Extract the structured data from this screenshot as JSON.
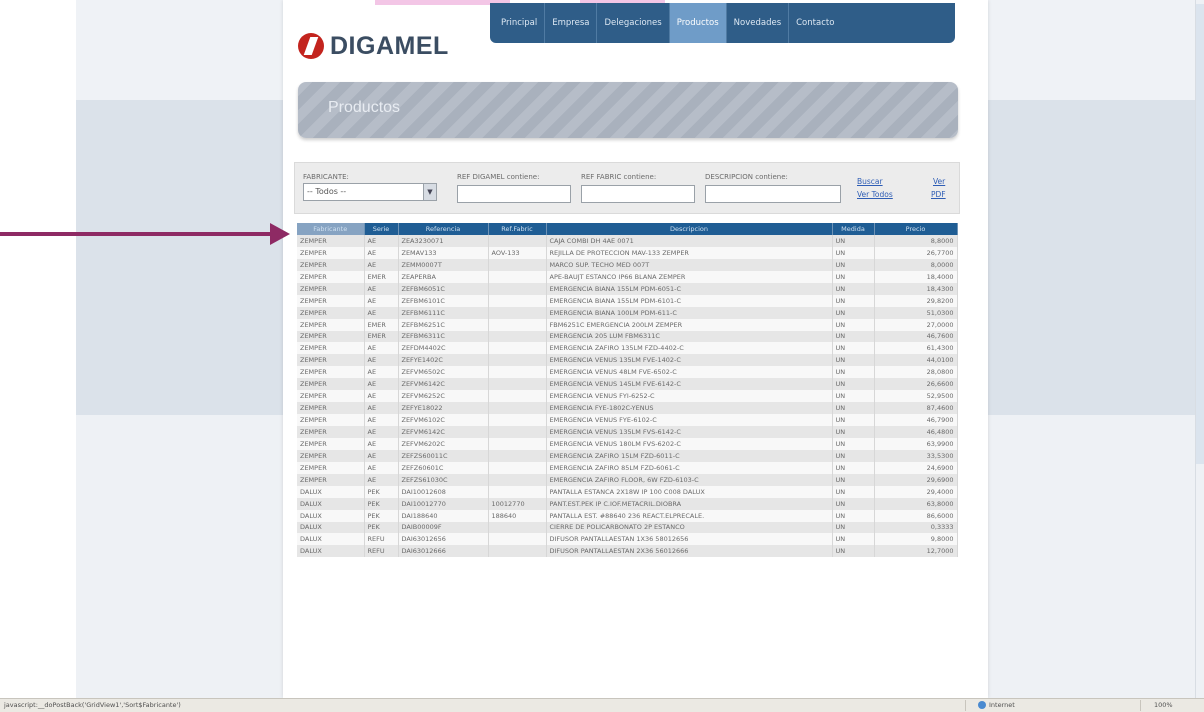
{
  "site": {
    "logo_text": "DIGAMEL",
    "colors": {
      "nav_bg": "#2f5d88",
      "nav_active": "#6f9cc8",
      "logo_red": "#c3241e",
      "table_header": "#1f5d94",
      "arrow": "#8e2a64"
    }
  },
  "nav": {
    "items": [
      "Principal",
      "Empresa",
      "Delegaciones",
      "Productos",
      "Novedades",
      "Contacto"
    ],
    "active": "Productos"
  },
  "banner": {
    "title": "Productos"
  },
  "filters": {
    "fabricante_label": "FABRICANTE:",
    "fabricante_value": "-- Todos --",
    "ref_digamel_label": "REF DIGAMEL contiene:",
    "ref_fabric_label": "REF FABRIC contiene:",
    "descripcion_label": "DESCRIPCION contiene:",
    "buscar_label": "Buscar",
    "ver_todos_label": "Ver Todos",
    "ver_label": "Ver",
    "pdf_label": "PDF"
  },
  "table": {
    "columns": [
      "Fabricante",
      "Serie",
      "Referencia",
      "Ref.Fabric",
      "Descripcion",
      "Medida",
      "Precio"
    ],
    "rows": [
      [
        "ZEMPER",
        "AE",
        "ZEA3230071",
        "",
        "CAJA COMBI DH 4AE 0071",
        "UN",
        "8,8000"
      ],
      [
        "ZEMPER",
        "AE",
        "ZEMAV133",
        "AOV-133",
        "REJILLA DE PROTECCION MAV-133 ZEMPER",
        "UN",
        "26,7700"
      ],
      [
        "ZEMPER",
        "AE",
        "ZEMM0007T",
        "",
        "MARCO SUP. TECHO MED 007T",
        "UN",
        "8,0000"
      ],
      [
        "ZEMPER",
        "EMER",
        "ZEAPERBA",
        "",
        "APE-BAUJT ESTANCO IP66 BLANA ZEMPER",
        "UN",
        "18,4000"
      ],
      [
        "ZEMPER",
        "AE",
        "ZEFBM6051C",
        "",
        "EMERGENCIA BIANA 155LM PDM-6051-C",
        "UN",
        "18,4300"
      ],
      [
        "ZEMPER",
        "AE",
        "ZEFBM6101C",
        "",
        "EMERGENCIA BIANA 155LM PDM-6101-C",
        "UN",
        "29,8200"
      ],
      [
        "ZEMPER",
        "AE",
        "ZEFBM6111C",
        "",
        "EMERGENCIA BIANA 100LM PDM-611-C",
        "UN",
        "51,0300"
      ],
      [
        "ZEMPER",
        "EMER",
        "ZEFBM6251C",
        "",
        "FBM6251C EMERGENCIA 200LM ZEMPER",
        "UN",
        "27,0000"
      ],
      [
        "ZEMPER",
        "EMER",
        "ZEFBM6311C",
        "",
        "EMERGENCIA 205 LUM FBM6311C",
        "UN",
        "46,7600"
      ],
      [
        "ZEMPER",
        "AE",
        "ZEFDM4402C",
        "",
        "EMERGENCIA ZAFIRO 135LM FZD-4402-C",
        "UN",
        "61,4300"
      ],
      [
        "ZEMPER",
        "AE",
        "ZEFYE1402C",
        "",
        "EMERGENCIA VENUS 135LM FVE-1402-C",
        "UN",
        "44,0100"
      ],
      [
        "ZEMPER",
        "AE",
        "ZEFVM6502C",
        "",
        "EMERGENCIA VENUS 48LM FVE-6502-C",
        "UN",
        "28,0800"
      ],
      [
        "ZEMPER",
        "AE",
        "ZEFVM6142C",
        "",
        "EMERGENCIA VENUS 145LM FVE-6142-C",
        "UN",
        "26,6600"
      ],
      [
        "ZEMPER",
        "AE",
        "ZEFVM6252C",
        "",
        "EMERGENCIA VENUS FYI-6252-C",
        "UN",
        "52,9500"
      ],
      [
        "ZEMPER",
        "AE",
        "ZEFYE18022",
        "",
        "EMERGENCIA FYE-1802C-YENUS",
        "UN",
        "87,4600"
      ],
      [
        "ZEMPER",
        "AE",
        "ZEFVM6102C",
        "",
        "EMERGENCIA VENUS FYE-6102-C",
        "UN",
        "46,7900"
      ],
      [
        "ZEMPER",
        "AE",
        "ZEFVM6142C",
        "",
        "EMERGENCIA VENUS 135LM FVS-6142-C",
        "UN",
        "46,4800"
      ],
      [
        "ZEMPER",
        "AE",
        "ZEFVM6202C",
        "",
        "EMERGENCIA VENUS 180LM FVS-6202-C",
        "UN",
        "63,9900"
      ],
      [
        "ZEMPER",
        "AE",
        "ZEFZS60011C",
        "",
        "EMERGENCIA ZAFIRO 15LM FZD-6011-C",
        "UN",
        "33,5300"
      ],
      [
        "ZEMPER",
        "AE",
        "ZEFZ60601C",
        "",
        "EMERGENCIA ZAFIRO 85LM FZD-6061-C",
        "UN",
        "24,6900"
      ],
      [
        "ZEMPER",
        "AE",
        "ZEFZS61030C",
        "",
        "EMERGENCIA ZAFIRO FLOOR, 6W FZD-6103-C",
        "UN",
        "29,6900"
      ],
      [
        "DALUX",
        "PEK",
        "DAI10012608",
        "",
        "PANTALLA ESTANCA 2X18W IP 100 C008 DALUX",
        "UN",
        "29,4000"
      ],
      [
        "DALUX",
        "PEK",
        "DAI10012770",
        "10012770",
        "PANT.EST.PEK IP C.IOF.METACRIL.DIOBRA",
        "UN",
        "63,8000"
      ],
      [
        "DALUX",
        "PEK",
        "DAI188640",
        "188640",
        "PANTALLA EST. #88640 236 REACT.ELPRECALE.",
        "UN",
        "86,6000"
      ],
      [
        "DALUX",
        "PEK",
        "DAIB00009F",
        "",
        "CIERRE DE POLICARBONATO 2P ESTANCO",
        "UN",
        "0,3333"
      ],
      [
        "DALUX",
        "REFU",
        "DAI63012656",
        "",
        "DIFUSOR PANTALLAESTAN 1X36 58012656",
        "UN",
        "9,8000"
      ],
      [
        "DALUX",
        "REFU",
        "DAI63012666",
        "",
        "DIFUSOR PANTALLAESTAN 2X36 56012666",
        "UN",
        "12,7000"
      ]
    ]
  },
  "statusbar": {
    "url_text": "javascript:__doPostBack('GridView1','Sort$Fabricante')",
    "zone_text": "Internet",
    "zoom_text": "100%"
  }
}
